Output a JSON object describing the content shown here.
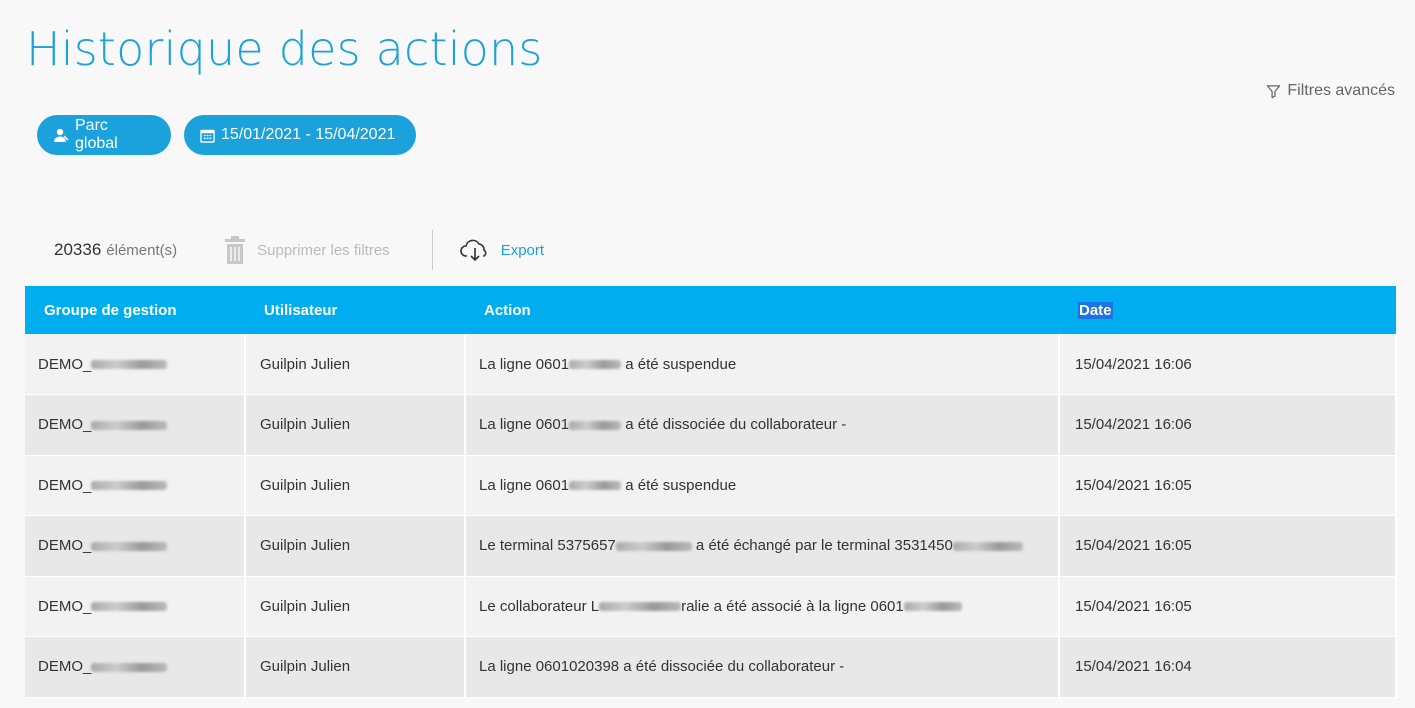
{
  "page": {
    "title": "Historique des actions",
    "advanced_filters_label": "Filtres avancés"
  },
  "chips": {
    "parc": "Parc global",
    "date_range": "15/01/2021 - 15/04/2021"
  },
  "toolbar": {
    "count": "20336",
    "count_label": "élément(s)",
    "delete_filters_label": "Supprimer les filtres",
    "export_label": "Export"
  },
  "table": {
    "columns": [
      "Groupe de gestion",
      "Utilisateur",
      "Action",
      "Date"
    ],
    "rows": [
      {
        "group": "DEMO_",
        "user": "Guilpin Julien",
        "action_a": "La ligne 0601",
        "action_b": " a été suspendue",
        "date": "15/04/2021 16:06"
      },
      {
        "group": "DEMO_",
        "user": "Guilpin Julien",
        "action_a": "La ligne 0601",
        "action_b": " a été dissociée du collaborateur -",
        "date": "15/04/2021 16:06"
      },
      {
        "group": "DEMO_",
        "user": "Guilpin Julien",
        "action_a": "La ligne 0601",
        "action_b": " a été suspendue",
        "date": "15/04/2021 16:05"
      },
      {
        "group": "DEMO_",
        "user": "Guilpin Julien",
        "action_a": "Le terminal 5375657",
        "action_b": " a été échangé par le terminal 3531450",
        "date": "15/04/2021 16:05"
      },
      {
        "group": "DEMO_",
        "user": "Guilpin Julien",
        "action_a": "Le collaborateur L",
        "action_b": "ralie a été associé à la ligne 0601",
        "date": "15/04/2021 16:05"
      },
      {
        "group": "DEMO_",
        "user": "Guilpin Julien",
        "action_a": "La ligne 0601020398 a été dissociée du collaborateur -",
        "action_b": "",
        "date": "15/04/2021 16:04"
      }
    ]
  },
  "icons": {
    "user_icon": "user-icon",
    "calendar_icon": "calendar-icon",
    "filter_icon": "filter-icon",
    "trash_icon": "trash-icon",
    "cloud_download_icon": "cloud-download-icon"
  }
}
